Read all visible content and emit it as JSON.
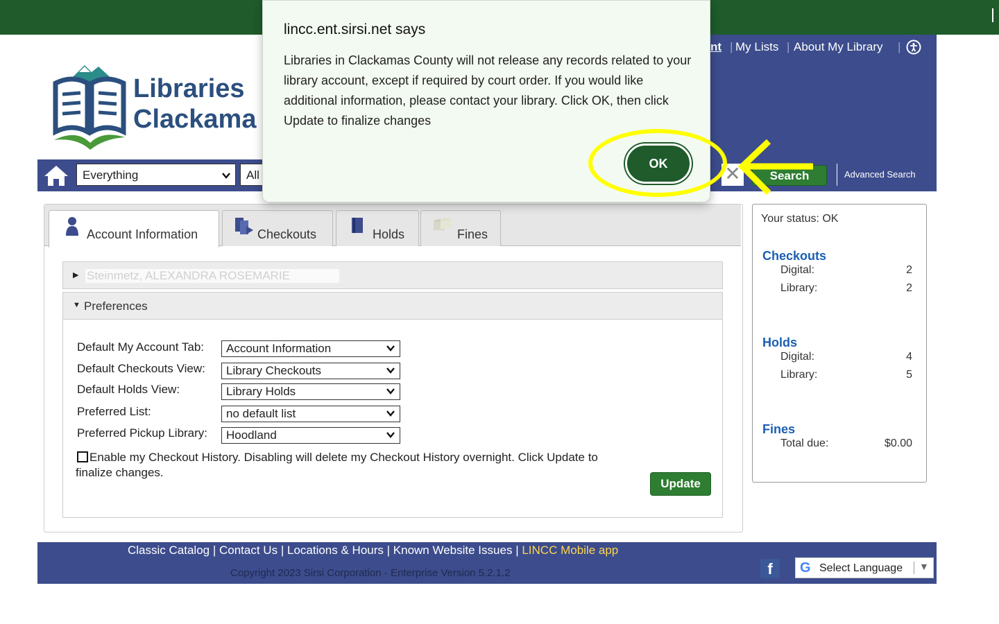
{
  "colors": {
    "topbar": "#1f5b2b",
    "brand_blue": "#3c4c8c",
    "accent_green": "#2e7d32",
    "highlight": "#ffff00",
    "link_blue": "#1a5fb4"
  },
  "header": {
    "logo_text_line1": "Libraries",
    "logo_text_line2": "Clackama",
    "top_links": {
      "account_partial": "nt",
      "my_lists": "My Lists",
      "about": "About My Library",
      "sep": "|"
    },
    "accessibility_icon": "accessibility-icon"
  },
  "search": {
    "scope_value": "Everything",
    "library_value": "All",
    "clear_glyph": "✕",
    "search_label": "Search",
    "advanced_label": "Advanced Search"
  },
  "tabs": [
    {
      "label": "Account Information",
      "icon": "person-icon"
    },
    {
      "label": "Checkouts",
      "icon": "books-icon"
    },
    {
      "label": "Holds",
      "icon": "book-icon"
    },
    {
      "label": "Fines",
      "icon": "coins-icon"
    }
  ],
  "account": {
    "patron_name": "Steinmetz, ALEXANDRA ROSEMARIE",
    "preferences_label": "Preferences",
    "fields": [
      {
        "label": "Default My Account Tab:",
        "value": "Account Information"
      },
      {
        "label": "Default Checkouts View:",
        "value": "Library Checkouts"
      },
      {
        "label": "Default Holds View:",
        "value": "Library Holds"
      },
      {
        "label": "Preferred List:",
        "value": "no default list"
      },
      {
        "label": "Preferred Pickup Library:",
        "value": "Hoodland"
      }
    ],
    "history_text": "Enable my Checkout History. Disabling will delete my Checkout History overnight. Click Update to finalize changes.",
    "history_checked": false,
    "update_label": "Update"
  },
  "status": {
    "status_text": "Your status: OK",
    "checkouts": {
      "title": "Checkouts",
      "digital_label": "Digital:",
      "digital": "2",
      "library_label": "Library:",
      "library": "2"
    },
    "holds": {
      "title": "Holds",
      "digital_label": "Digital:",
      "digital": "4",
      "library_label": "Library:",
      "library": "5"
    },
    "fines": {
      "title": "Fines",
      "total_label": "Total due:",
      "total": "$0.00"
    }
  },
  "footer": {
    "links": [
      "Classic Catalog",
      "Contact Us",
      "Locations & Hours",
      "Known Website Issues"
    ],
    "mobile_link": "LINCC Mobile app",
    "sep": "|",
    "copyright": "Copyright 2023 Sirsi Corporation - Enterprise Version 5.2.1.2",
    "facebook_glyph": "f",
    "translate_g": "G",
    "translate_label": "Select Language",
    "translate_arrow": "▼"
  },
  "dialog": {
    "title": "lincc.ent.sirsi.net says",
    "message": "Libraries in Clackamas County will not release any records related to your library account, except if required by court order. If you would like additional information, please contact your library. Click OK, then click Update to finalize changes",
    "ok_label": "OK"
  }
}
